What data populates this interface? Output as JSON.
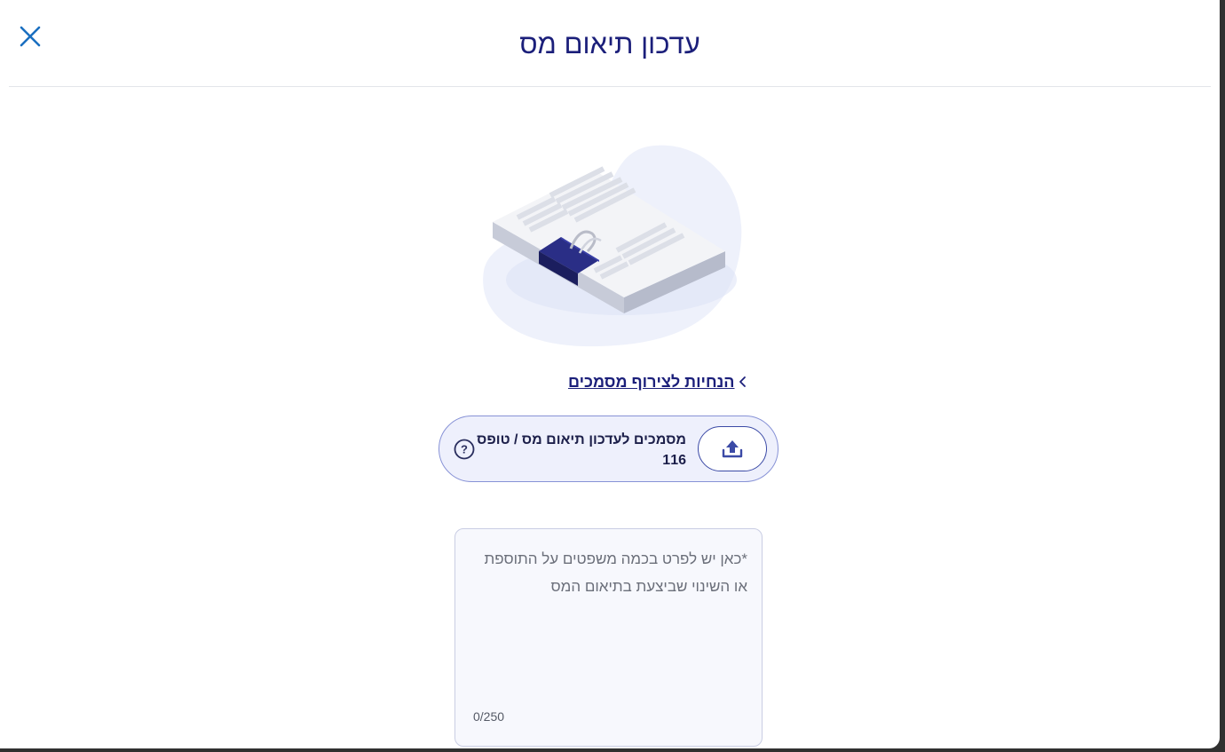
{
  "modal": {
    "title": "עדכון תיאום מס",
    "close_icon": "close-icon"
  },
  "illustration": {
    "name": "documents-with-binder-clip-illustration"
  },
  "guide_link": {
    "label": "הנחיות לצירוף מסמכים",
    "icon": "chevron-left-icon"
  },
  "upload": {
    "label": "מסמכים לעדכון תיאום מס / טופס 116",
    "upload_icon": "upload-icon",
    "help_icon": "question-circle-icon"
  },
  "details": {
    "value": "",
    "placeholder": "*כאן יש לפרט בכמה משפטים על התוספת או השינוי שביצעת בתיאום המס",
    "counter": "0/250"
  },
  "colors": {
    "primary": "#1b1f7a",
    "accent_blue": "#1a6fc0",
    "upload_card_bg": "#eef0fc",
    "upload_card_border": "#8792d6",
    "divider": "#e3e5ea"
  }
}
